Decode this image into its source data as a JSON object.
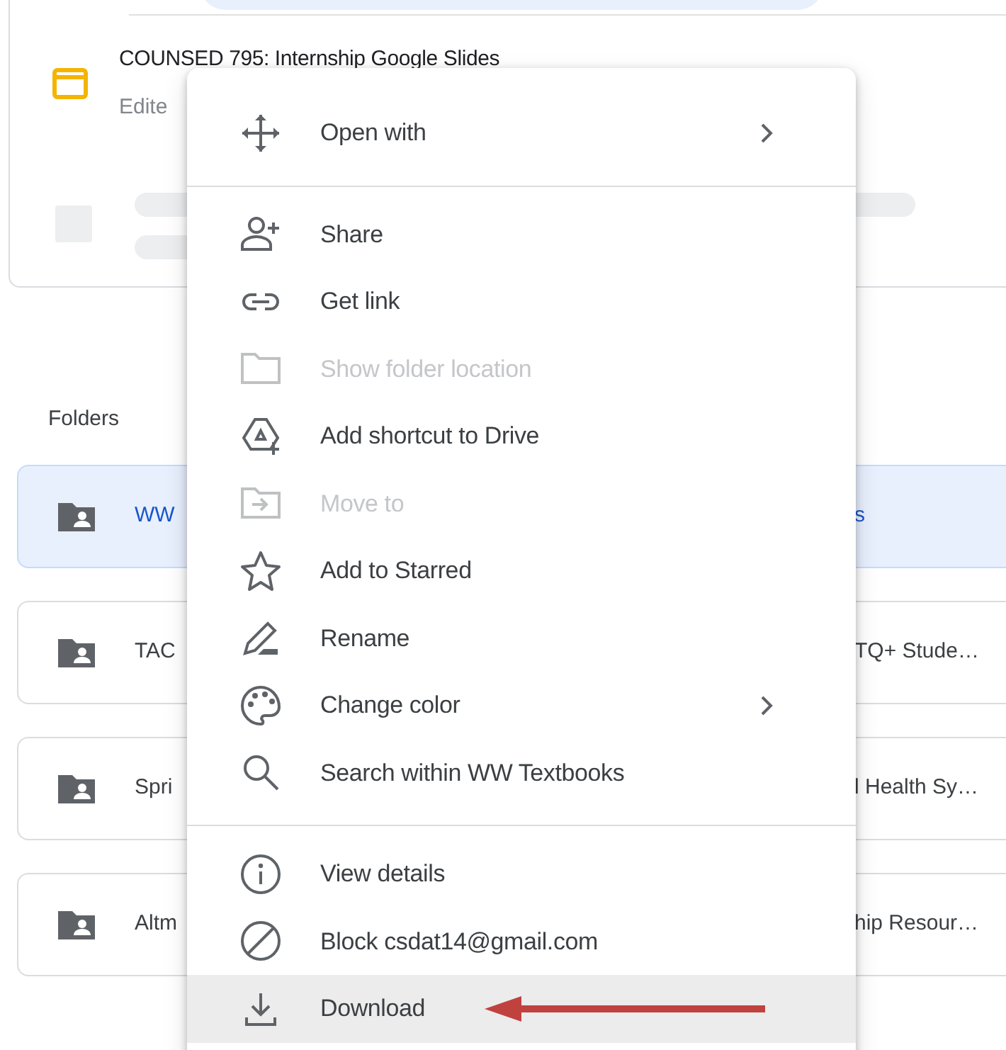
{
  "recent_file": {
    "title": "COUNSED 795: Internship Google Slides",
    "subtitle": "Edite"
  },
  "folders_heading": "Folders",
  "folder_rows": [
    {
      "left": {
        "name": "WW",
        "selected": true
      },
      "right": {
        "name": "s",
        "selected": true
      }
    },
    {
      "left": {
        "name": "TAC",
        "selected": false
      },
      "right": {
        "name": "TQ+ Stude…",
        "selected": false
      }
    },
    {
      "left": {
        "name": "Spri",
        "selected": false
      },
      "right": {
        "name": "l Health Sy…",
        "selected": false
      }
    },
    {
      "left": {
        "name": "Altm",
        "selected": false
      },
      "right": {
        "name": "hip Resour…",
        "selected": false
      }
    }
  ],
  "context_menu": {
    "sections": [
      [
        {
          "kind": "move",
          "label": "Open with",
          "submenu": true,
          "disabled": false,
          "highlighted": false,
          "arrow_marked": false
        }
      ],
      [
        {
          "kind": "share",
          "label": "Share",
          "submenu": false,
          "disabled": false,
          "highlighted": false,
          "arrow_marked": false
        },
        {
          "kind": "link",
          "label": "Get link",
          "submenu": false,
          "disabled": false,
          "highlighted": false,
          "arrow_marked": false
        },
        {
          "kind": "folder",
          "label": "Show folder location",
          "submenu": false,
          "disabled": true,
          "highlighted": false,
          "arrow_marked": false
        },
        {
          "kind": "shortcut",
          "label": "Add shortcut to Drive",
          "submenu": false,
          "disabled": false,
          "highlighted": false,
          "arrow_marked": false
        },
        {
          "kind": "move_to",
          "label": "Move to",
          "submenu": false,
          "disabled": true,
          "highlighted": false,
          "arrow_marked": false
        },
        {
          "kind": "star",
          "label": "Add to Starred",
          "submenu": false,
          "disabled": false,
          "highlighted": false,
          "arrow_marked": false
        },
        {
          "kind": "pencil",
          "label": "Rename",
          "submenu": false,
          "disabled": false,
          "highlighted": false,
          "arrow_marked": false
        },
        {
          "kind": "palette",
          "label": "Change color",
          "submenu": true,
          "disabled": false,
          "highlighted": false,
          "arrow_marked": false
        },
        {
          "kind": "search",
          "label": "Search within WW Textbooks",
          "submenu": false,
          "disabled": false,
          "highlighted": false,
          "arrow_marked": false
        }
      ],
      [
        {
          "kind": "info",
          "label": "View details",
          "submenu": false,
          "disabled": false,
          "highlighted": false,
          "arrow_marked": false
        },
        {
          "kind": "block",
          "label": "Block csdat14@gmail.com",
          "submenu": false,
          "disabled": false,
          "highlighted": false,
          "arrow_marked": false
        },
        {
          "kind": "download",
          "label": "Download",
          "submenu": false,
          "disabled": false,
          "highlighted": true,
          "arrow_marked": true
        }
      ]
    ]
  }
}
